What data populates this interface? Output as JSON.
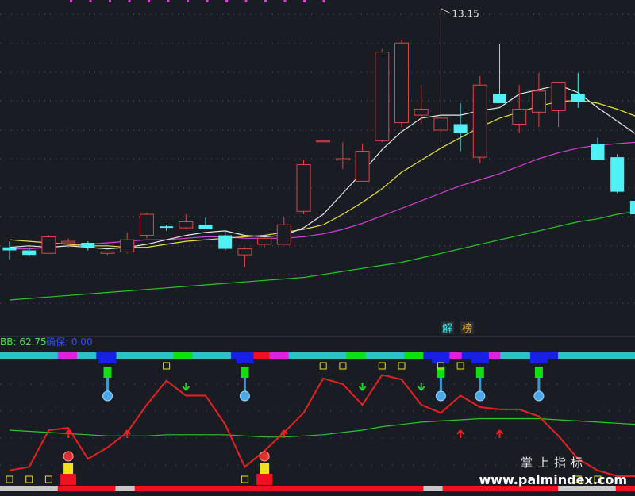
{
  "chart_data": [
    {
      "type": "candlestick",
      "panel": "price",
      "title": "",
      "max_label": "13.15",
      "annotations": [
        "解",
        "榜"
      ],
      "colors": {
        "up": "#e24545",
        "down": "#4ff0f6",
        "ma5": "#e8e8e8",
        "ma10": "#e8e040",
        "ma20": "#d83fd8",
        "ma60": "#28c828"
      },
      "price_range": [
        3.0,
        13.3
      ],
      "candles": [
        {
          "o": 5.2,
          "h": 5.4,
          "l": 4.8,
          "c": 5.1
        },
        {
          "o": 5.1,
          "h": 5.2,
          "l": 4.9,
          "c": 4.95
        },
        {
          "o": 5.0,
          "h": 5.6,
          "l": 5.0,
          "c": 5.55
        },
        {
          "o": 5.35,
          "h": 5.5,
          "l": 5.2,
          "c": 5.4
        },
        {
          "o": 5.35,
          "h": 5.4,
          "l": 5.1,
          "c": 5.2
        },
        {
          "o": 5.0,
          "h": 5.05,
          "l": 4.95,
          "c": 5.05
        },
        {
          "o": 5.05,
          "h": 5.7,
          "l": 5.0,
          "c": 5.45
        },
        {
          "o": 5.6,
          "h": 6.35,
          "l": 5.5,
          "c": 6.3
        },
        {
          "o": 5.9,
          "h": 5.95,
          "l": 5.75,
          "c": 5.85
        },
        {
          "o": 5.85,
          "h": 6.3,
          "l": 5.8,
          "c": 6.05
        },
        {
          "o": 5.95,
          "h": 6.2,
          "l": 5.85,
          "c": 5.8
        },
        {
          "o": 5.6,
          "h": 5.75,
          "l": 5.1,
          "c": 5.15
        },
        {
          "o": 4.95,
          "h": 5.2,
          "l": 4.55,
          "c": 5.15
        },
        {
          "o": 5.3,
          "h": 5.55,
          "l": 5.2,
          "c": 5.5
        },
        {
          "o": 5.3,
          "h": 6.2,
          "l": 5.3,
          "c": 5.95
        },
        {
          "o": 6.4,
          "h": 8.1,
          "l": 6.3,
          "c": 7.95
        },
        {
          "o": 8.75,
          "h": 8.75,
          "l": 8.7,
          "c": 8.75
        },
        {
          "o": 8.15,
          "h": 8.7,
          "l": 7.8,
          "c": 8.15
        },
        {
          "o": 7.4,
          "h": 8.65,
          "l": 7.4,
          "c": 8.4
        },
        {
          "o": 8.75,
          "h": 11.8,
          "l": 8.7,
          "c": 11.7
        },
        {
          "o": 9.35,
          "h": 12.1,
          "l": 9.2,
          "c": 12.0
        },
        {
          "o": 9.6,
          "h": 10.6,
          "l": 9.3,
          "c": 9.8
        },
        {
          "o": 9.1,
          "h": 13.15,
          "l": 8.7,
          "c": 9.5
        },
        {
          "o": 9.3,
          "h": 10.0,
          "l": 8.4,
          "c": 9.0
        },
        {
          "o": 8.2,
          "h": 10.9,
          "l": 8.0,
          "c": 10.6
        },
        {
          "o": 10.3,
          "h": 11.95,
          "l": 10.0,
          "c": 10.0
        },
        {
          "o": 9.3,
          "h": 10.6,
          "l": 9.0,
          "c": 9.8
        },
        {
          "o": 9.7,
          "h": 11.0,
          "l": 9.2,
          "c": 10.4
        },
        {
          "o": 9.75,
          "h": 10.4,
          "l": 9.2,
          "c": 10.7
        },
        {
          "o": 10.3,
          "h": 11.0,
          "l": 9.85,
          "c": 10.05
        },
        {
          "o": 8.65,
          "h": 8.85,
          "l": 8.15,
          "c": 8.1
        },
        {
          "o": 8.2,
          "h": 8.3,
          "l": 7.0,
          "c": 7.05
        },
        {
          "o": 6.75,
          "h": 6.85,
          "l": 6.3,
          "c": 6.3
        }
      ],
      "ma5": [
        5.2,
        5.25,
        5.2,
        5.25,
        5.2,
        5.15,
        5.2,
        5.3,
        5.45,
        5.6,
        5.7,
        5.75,
        5.6,
        5.55,
        5.6,
        5.85,
        6.3,
        7.0,
        7.7,
        8.45,
        9.05,
        9.5,
        9.6,
        9.6,
        9.75,
        9.85,
        10.3,
        10.45,
        10.6,
        10.35,
        9.85,
        9.4,
        8.95
      ],
      "ma10": [
        5.45,
        5.4,
        5.35,
        5.3,
        5.25,
        5.25,
        5.2,
        5.2,
        5.3,
        5.4,
        5.45,
        5.5,
        5.55,
        5.6,
        5.7,
        5.8,
        5.95,
        6.3,
        6.7,
        7.15,
        7.7,
        8.1,
        8.5,
        8.85,
        9.2,
        9.5,
        9.7,
        9.9,
        10.05,
        10.1,
        10.0,
        9.8,
        9.55
      ],
      "ma20": [
        5.15,
        5.15,
        5.2,
        5.25,
        5.3,
        5.35,
        5.4,
        5.45,
        5.45,
        5.5,
        5.55,
        5.55,
        5.5,
        5.5,
        5.5,
        5.55,
        5.65,
        5.8,
        6.0,
        6.25,
        6.5,
        6.75,
        7.0,
        7.25,
        7.45,
        7.65,
        7.9,
        8.15,
        8.35,
        8.5,
        8.6,
        8.65,
        8.7
      ],
      "ma60": [
        3.45,
        3.5,
        3.55,
        3.6,
        3.65,
        3.7,
        3.75,
        3.8,
        3.85,
        3.9,
        3.95,
        4.0,
        4.05,
        4.1,
        4.15,
        4.2,
        4.3,
        4.4,
        4.5,
        4.6,
        4.7,
        4.85,
        5.0,
        5.15,
        5.3,
        5.45,
        5.6,
        5.75,
        5.9,
        6.05,
        6.15,
        6.3,
        6.4
      ]
    },
    {
      "type": "line",
      "panel": "indicator",
      "legend_label": "BB: 62.75",
      "legend_label2": "确保: 0.00",
      "y_range": [
        0,
        100
      ],
      "series": [
        {
          "name": "BB",
          "color": "#e82020",
          "values": [
            5,
            8,
            40,
            42,
            15,
            25,
            38,
            62,
            83,
            70,
            70,
            45,
            8,
            22,
            38,
            55,
            85,
            80,
            62,
            88,
            84,
            62,
            55,
            70,
            60,
            58,
            58,
            52,
            35,
            15,
            5,
            0,
            0
          ]
        },
        {
          "name": "",
          "color": "#28c828",
          "values": [
            40,
            39,
            38,
            37,
            36,
            35,
            35,
            35,
            36,
            36,
            36,
            36,
            35,
            34,
            34,
            35,
            36,
            38,
            40,
            43,
            45,
            47,
            48,
            49,
            50,
            50,
            50,
            50,
            49,
            48,
            47,
            46,
            45
          ]
        }
      ],
      "top_bar_segments": [
        "cyan",
        "cyan",
        "cyan",
        "magenta",
        "cyan",
        "blue",
        "cyan",
        "cyan",
        "cyan",
        "green",
        "cyan",
        "cyan",
        "blue",
        "red",
        "magenta",
        "cyan",
        "cyan",
        "cyan",
        "green",
        "cyan",
        "cyan",
        "green",
        "blue",
        "magenta",
        "blue",
        "magenta",
        "cyan",
        "cyan",
        "blue",
        "cyan",
        "cyan",
        "cyan",
        "cyan"
      ],
      "bottom_bar_segments": [
        "white",
        "white",
        "white",
        "red",
        "red",
        "red",
        "white",
        "red",
        "red",
        "red",
        "red",
        "red",
        "red",
        "red",
        "red",
        "red",
        "red",
        "red",
        "red",
        "red",
        "red",
        "red",
        "white",
        "red",
        "red",
        "red",
        "red",
        "red",
        "red",
        "white",
        "white",
        "white",
        "red"
      ],
      "blue_markers": [
        5,
        12,
        22,
        24,
        27
      ],
      "yellow_squares_top": [
        8,
        16,
        17,
        19,
        20,
        22,
        23
      ],
      "yellow_squares_bottom": [
        0,
        1,
        2,
        12,
        29,
        30
      ],
      "green_arrows_down": [
        9,
        18,
        21
      ],
      "red_arrows_up": [
        3,
        6,
        14,
        23,
        25
      ],
      "red_ball_markers": [
        3,
        13
      ]
    }
  ],
  "watermark": {
    "title": "掌上指标",
    "url": "www.palmindex.com"
  }
}
